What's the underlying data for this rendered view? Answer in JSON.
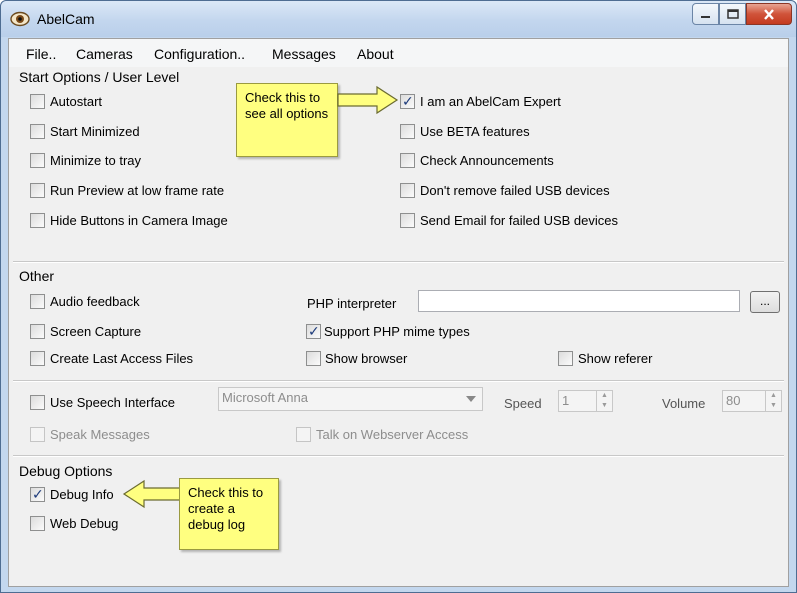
{
  "window": {
    "title": "AbelCam"
  },
  "menu": [
    {
      "label": "File..",
      "accel": "F"
    },
    {
      "label": "Cameras",
      "accel": "C"
    },
    {
      "label": "Configuration..",
      "accel": "n"
    },
    {
      "label": "Messages",
      "accel": "M"
    },
    {
      "label": "About",
      "accel": "A"
    }
  ],
  "start_options": {
    "title": "Start Options / User Level",
    "autostart": "Autostart",
    "start_minimized": "Start Minimized",
    "minimize_tray": "Minimize to tray",
    "run_preview": "Run Preview at low frame rate",
    "hide_buttons": "Hide Buttons in Camera Image",
    "expert": "I am an AbelCam Expert",
    "beta": "Use BETA features",
    "announcements": "Check Announcements",
    "dont_remove_usb": "Don't remove failed USB devices",
    "send_email_usb": "Send Email for failed USB devices"
  },
  "other": {
    "title": "Other",
    "audio_feedback": "Audio feedback",
    "screen_capture": "Screen Capture",
    "last_access": "Create Last Access Files",
    "php_label": "PHP interpreter",
    "php_value": "",
    "browse_label": "...",
    "php_mime": "Support PHP mime types",
    "show_browser": "Show browser",
    "show_referer": "Show referer"
  },
  "speech": {
    "use_speech": "Use Speech Interface",
    "voice": "Microsoft Anna",
    "speed_label": "Speed",
    "speed_value": "1",
    "volume_label": "Volume",
    "volume_value": "80",
    "speak_messages": "Speak Messages",
    "talk_webserver": "Talk on Webserver Access"
  },
  "debug": {
    "title": "Debug Options",
    "debug_info": "Debug Info",
    "web_debug": "Web Debug"
  },
  "callouts": {
    "expert_note": "Check this to see all options",
    "debug_note": "Check this to create a debug log"
  },
  "checked": {
    "expert": true,
    "php_mime": true,
    "debug_info": true
  }
}
